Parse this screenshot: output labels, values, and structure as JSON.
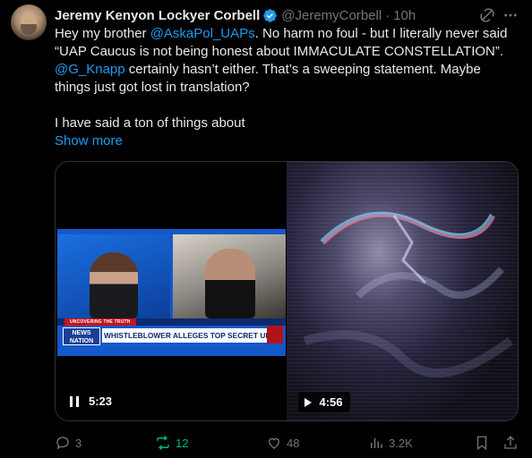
{
  "author": {
    "name": "Jeremy Kenyon Lockyer Corbell",
    "handle": "@JeremyCorbell",
    "separator": "·",
    "time": "10h"
  },
  "tweet": {
    "line1_a": "Hey my brother ",
    "mention1": "@AskaPol_UAPs",
    "line1_b": ". No harm no foul - but I literally never said",
    "line2": "“UAP Caucus is not being honest about IMMACULATE CONSTELLATION”.",
    "mention2": "@G_Knapp",
    "line3_b": " certainly hasn’t either. That’s a sweeping statement. Maybe",
    "line4": "things just got lost in translation?",
    "line5": "I have said a ton of things about",
    "show_more": "Show more"
  },
  "media": {
    "left_video": {
      "banner_label": "UNCOVERING THE TRUTH",
      "network_line1": "NEWS",
      "network_line2": "NATION",
      "headline": "WHISTLEBLOWER ALLEGES TOP SECRET UFO PROGRAM",
      "duration": "5:23",
      "state_icon": "pause-icon"
    },
    "right_video": {
      "duration": "4:56",
      "state_icon": "play-icon"
    }
  },
  "actions": {
    "replies": "3",
    "reposts": "12",
    "likes": "48",
    "views": "3.2K"
  },
  "colors": {
    "background": "#000000",
    "text": "#e7e9ea",
    "muted": "#71767b",
    "link": "#1d9bf0",
    "repost_active": "#00ba7c"
  }
}
